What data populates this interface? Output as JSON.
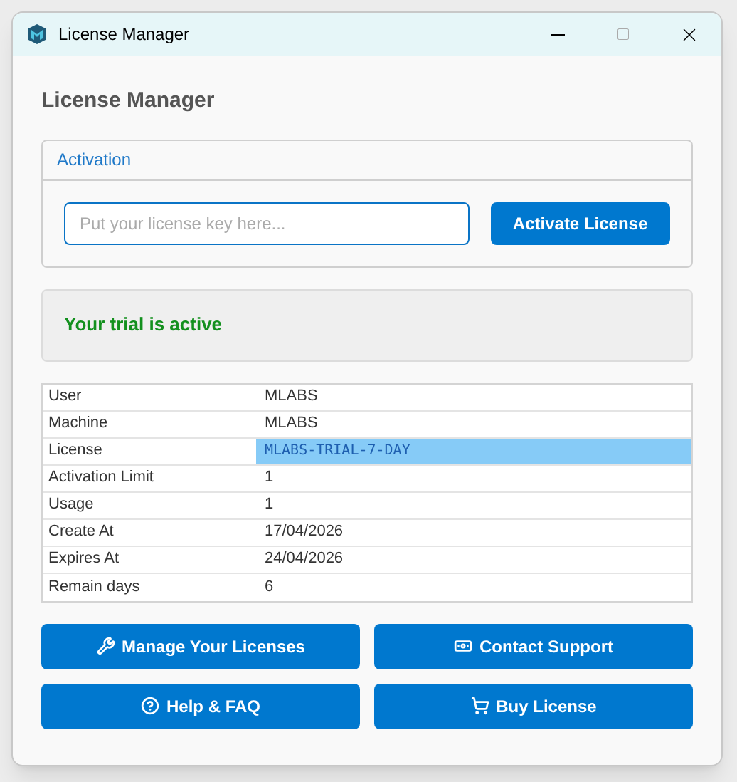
{
  "window": {
    "title": "License Manager"
  },
  "heading": "License Manager",
  "activation": {
    "title": "Activation",
    "placeholder": "Put your license key here...",
    "button": "Activate License"
  },
  "status": "Your trial is active",
  "details": [
    {
      "label": "User",
      "value": "MLABS",
      "selected": false
    },
    {
      "label": "Machine",
      "value": "MLABS",
      "selected": false
    },
    {
      "label": "License",
      "value": "MLABS-TRIAL-7-DAY",
      "selected": true
    },
    {
      "label": "Activation Limit",
      "value": "1",
      "selected": false
    },
    {
      "label": "Usage",
      "value": "1",
      "selected": false
    },
    {
      "label": "Create At",
      "value": "17/04/2026",
      "selected": false
    },
    {
      "label": "Expires At",
      "value": "24/04/2026",
      "selected": false
    },
    {
      "label": "Remain days",
      "value": "6",
      "selected": false
    }
  ],
  "buttons": [
    "Manage Your Licenses",
    "Contact Support",
    "Help & FAQ",
    "Buy License"
  ]
}
